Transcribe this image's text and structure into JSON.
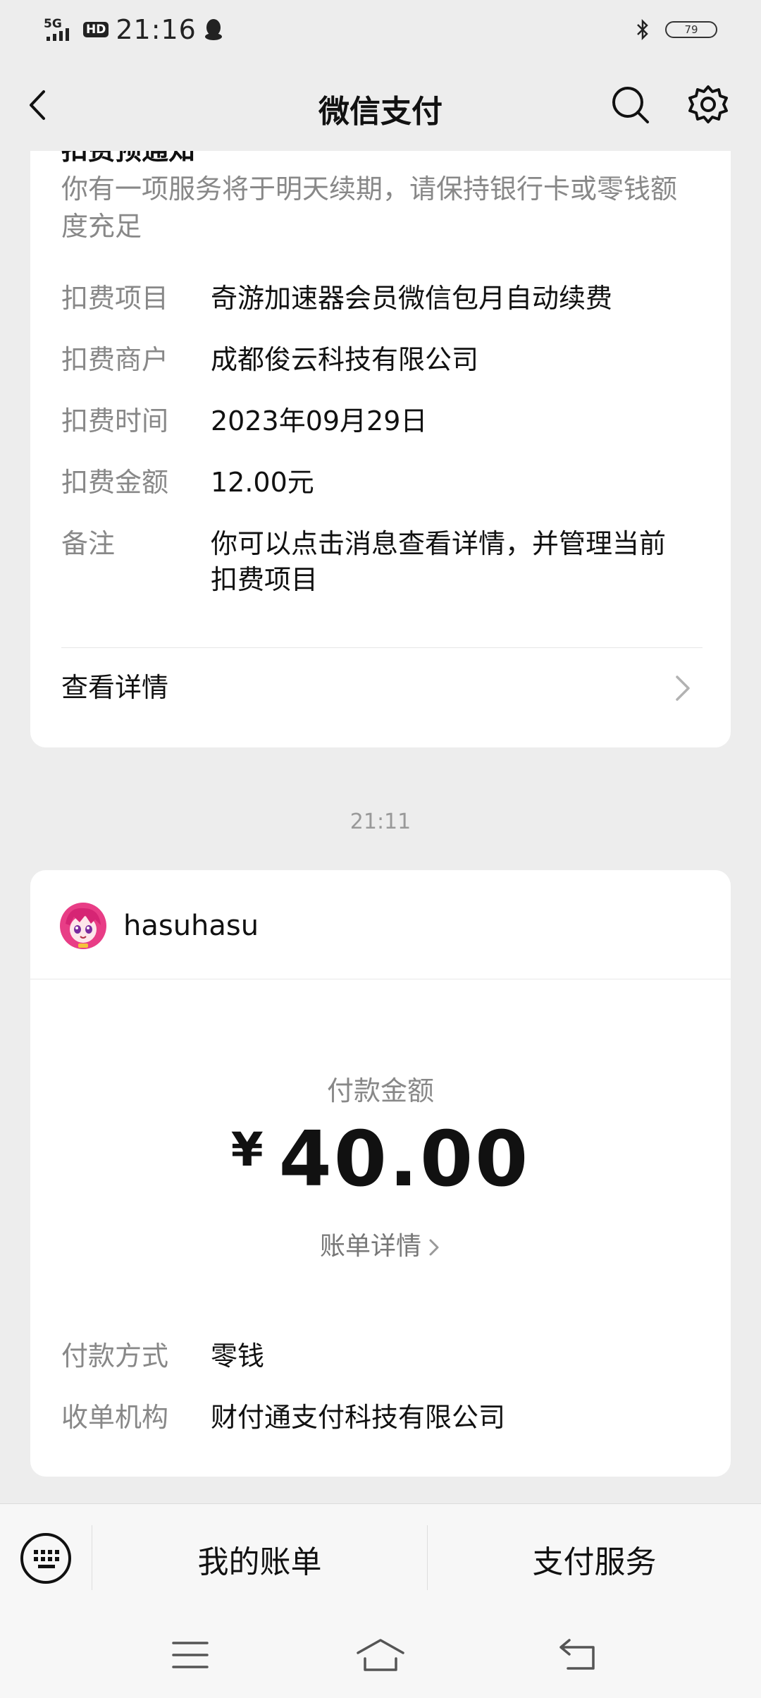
{
  "status_bar": {
    "network": "5G",
    "hd": "HD",
    "time": "21:16",
    "battery": "79"
  },
  "nav": {
    "title": "微信支付"
  },
  "notice_card": {
    "title": "扣费预通知",
    "description": "你有一项服务将于明天续期，请保持银行卡或零钱额度充足",
    "rows": [
      {
        "key": "扣费项目",
        "value": "奇游加速器会员微信包月自动续费"
      },
      {
        "key": "扣费商户",
        "value": "成都俊云科技有限公司"
      },
      {
        "key": "扣费时间",
        "value": "2023年09月29日"
      },
      {
        "key": "扣费金额",
        "value": "12.00元"
      },
      {
        "key": "备注",
        "value": "你可以点击消息查看详情，并管理当前扣费项目"
      }
    ],
    "link": "查看详情"
  },
  "timestamp": "21:11",
  "payment_card": {
    "merchant": "hasuhasu",
    "amount_label": "付款金额",
    "currency": "¥",
    "amount": "40.00",
    "bill_link": "账单详情",
    "rows": [
      {
        "key": "付款方式",
        "value": "零钱"
      },
      {
        "key": "收单机构",
        "value": "财付通支付科技有限公司"
      }
    ]
  },
  "bottom_tabs": {
    "bill": "我的账单",
    "service": "支付服务"
  },
  "icons": {
    "back": "chevron-left-icon",
    "search": "search-icon",
    "settings": "gear-icon",
    "keyboard": "keyboard-icon"
  }
}
